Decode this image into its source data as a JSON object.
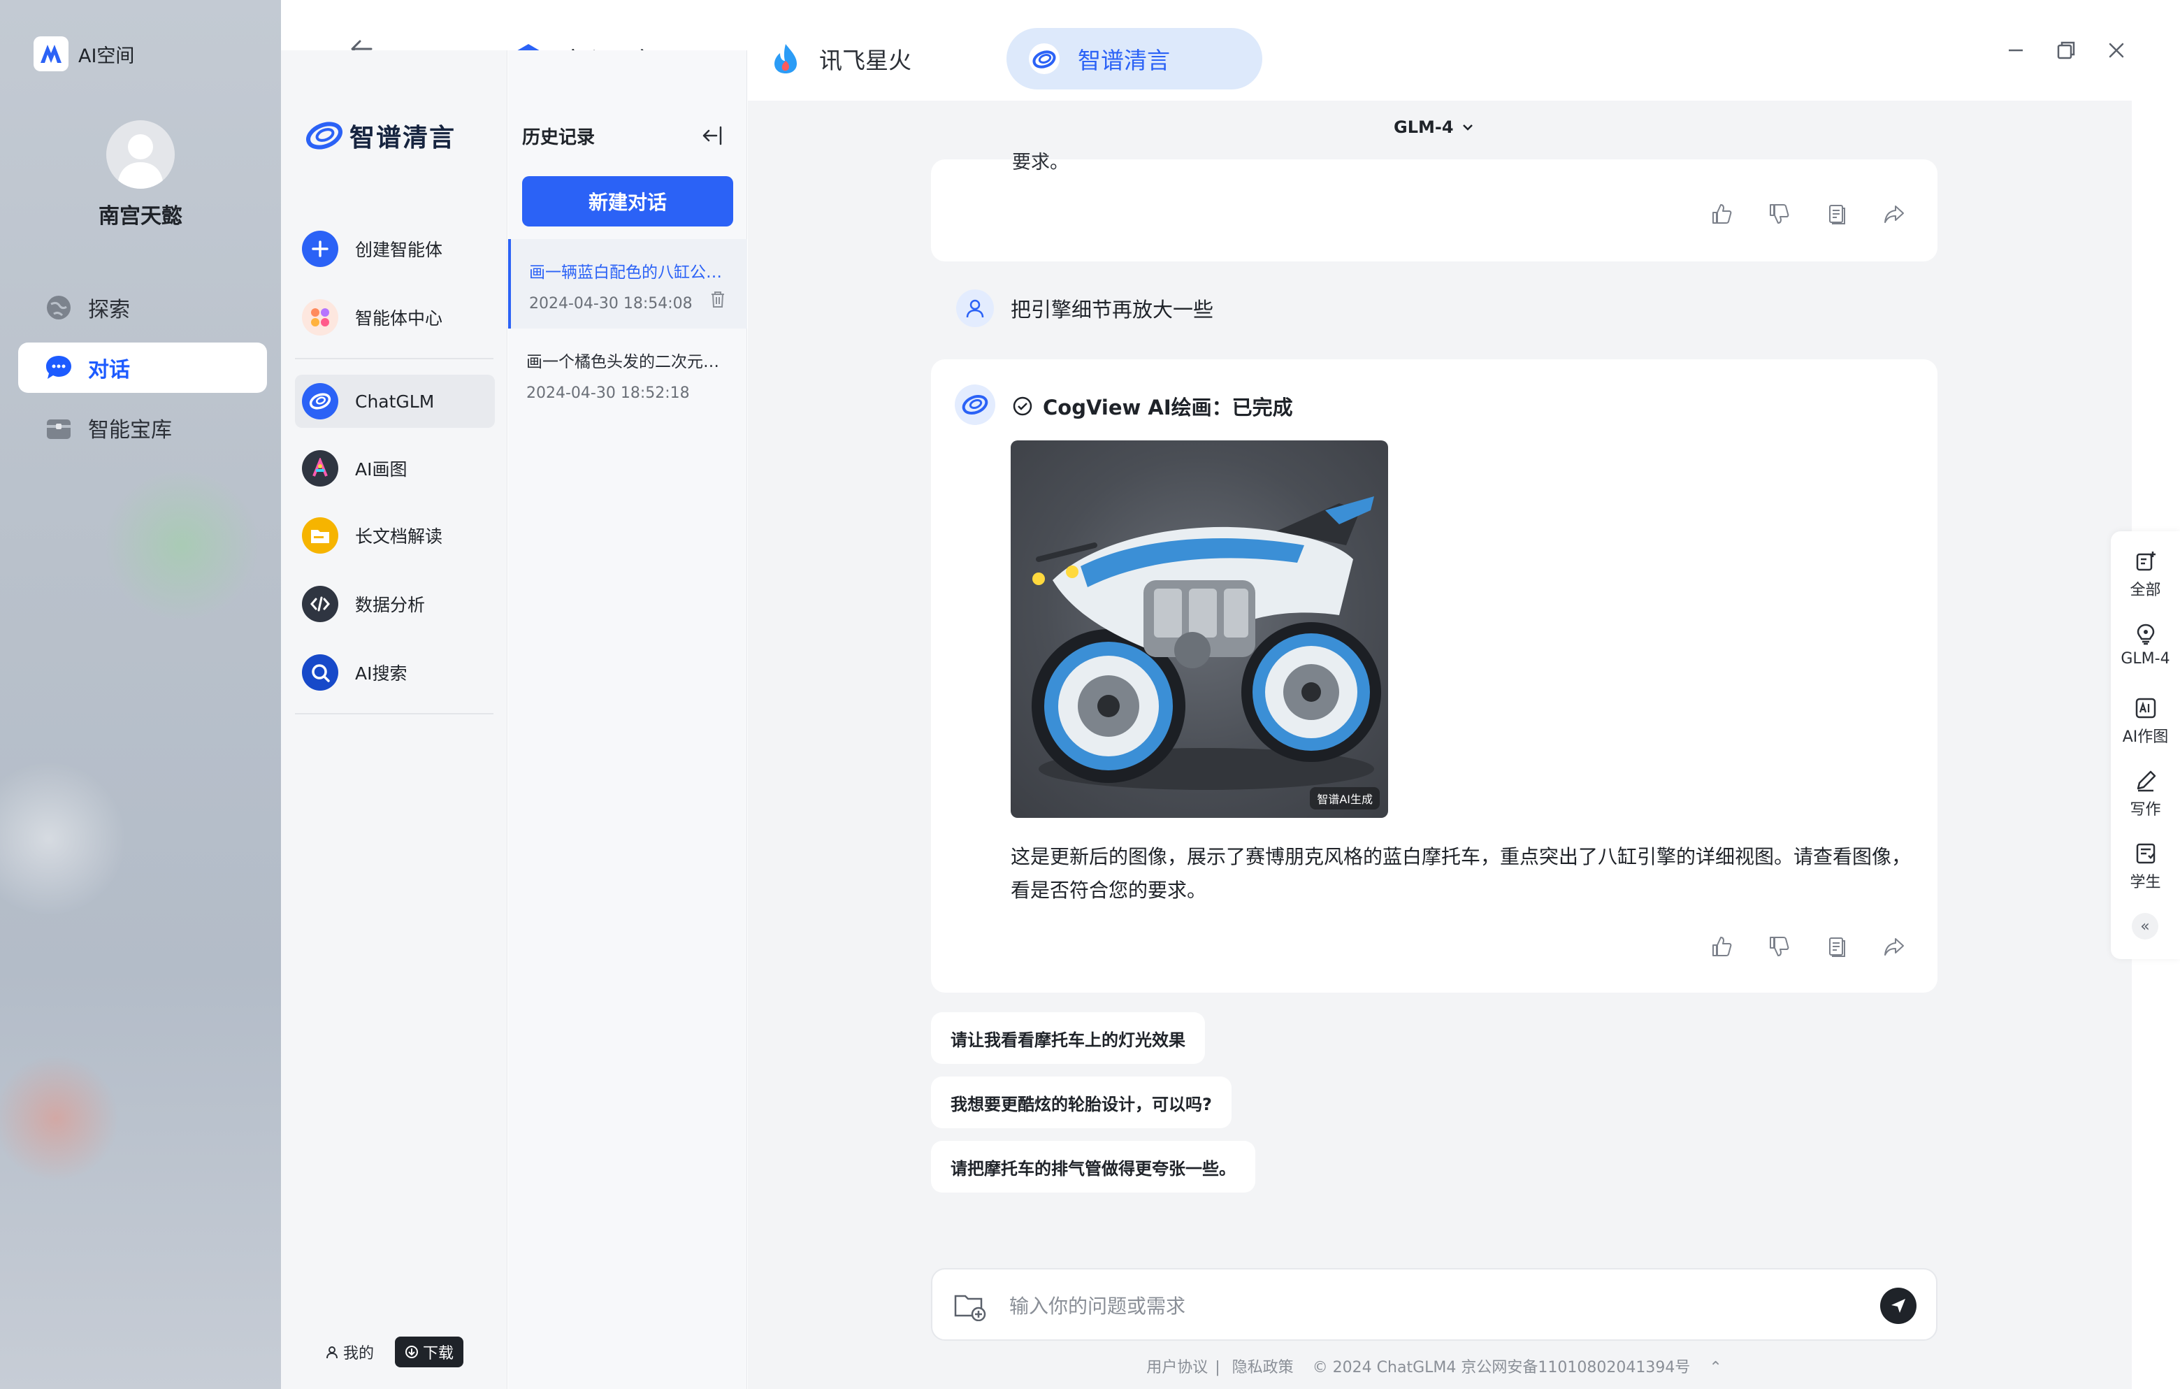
{
  "rail": {
    "app_title": "AI空间",
    "user_name": "南宫天懿",
    "nav": [
      {
        "label": "探索",
        "icon": "globe-icon"
      },
      {
        "label": "对话",
        "icon": "chat-bubble-icon",
        "active": true
      },
      {
        "label": "智能宝库",
        "icon": "treasure-box-icon"
      }
    ]
  },
  "tabs": [
    {
      "label": "文心一言",
      "icon": "wenxin-cube-icon"
    },
    {
      "label": "讯飞星火",
      "icon": "spark-flame-icon"
    },
    {
      "label": "智谱清言",
      "icon": "zhipu-ring-icon",
      "active": true
    }
  ],
  "bots": {
    "brand": "智谱清言",
    "items": [
      {
        "label": "创建智能体",
        "icon": "plus-circle-icon",
        "color": "#2b62f6"
      },
      {
        "label": "智能体中心",
        "icon": "agents-grid-icon",
        "color": "#ff8a5c"
      },
      {
        "label": "ChatGLM",
        "icon": "chatglm-icon",
        "color": "#2b62f6",
        "active": true
      },
      {
        "label": "AI画图",
        "icon": "ai-paint-icon",
        "color": "#2f3541"
      },
      {
        "label": "长文档解读",
        "icon": "folder-icon",
        "color": "#f6b400"
      },
      {
        "label": "数据分析",
        "icon": "code-icon",
        "color": "#2f3541"
      },
      {
        "label": "AI搜索",
        "icon": "ai-search-icon",
        "color": "#1749c9"
      }
    ],
    "mine": "我的",
    "download": "下载"
  },
  "history": {
    "title": "历史记录",
    "new_chat": "新建对话",
    "items": [
      {
        "name": "画一辆蓝白配色的八缸公升摩托车",
        "date": "2024-04-30 18:54:08",
        "active": true
      },
      {
        "name": "画一个橘色头发的二次元少女",
        "date": "2024-04-30 18:52:18"
      }
    ]
  },
  "chat": {
    "model": "GLM-4",
    "prev_tail": "要求。",
    "user_message": "把引擎细节再放大一些",
    "bot_title": "CogView AI绘画：已完成",
    "image_badge": "智谱AI生成",
    "reply": "这是更新后的图像，展示了赛博朋克风格的蓝白摩托车，重点突出了八缸引擎的详细视图。请查看图像，看是否符合您的要求。",
    "suggestions": [
      "请让我看看摩托车上的灯光效果",
      "我想要更酷炫的轮胎设计，可以吗?",
      "请把摩托车的排气管做得更夸张一些。"
    ],
    "input_placeholder": "输入你的问题或需求"
  },
  "footer": {
    "terms": "用户协议",
    "privacy": "隐私政策",
    "copyright": "© 2024 ChatGLM4 京公网安备11010802041394号"
  },
  "tools": [
    {
      "label": "全部",
      "icon": "all-add-icon"
    },
    {
      "label": "GLM-4",
      "icon": "bulb-icon"
    },
    {
      "label": "AI作图",
      "icon": "ai-image-icon"
    },
    {
      "label": "写作",
      "icon": "pen-icon"
    },
    {
      "label": "学生",
      "icon": "student-icon"
    }
  ],
  "colors": {
    "accent": "#2b62f6",
    "tab_active_bg": "#dde9fb",
    "main_bg": "#f3f4f6"
  }
}
